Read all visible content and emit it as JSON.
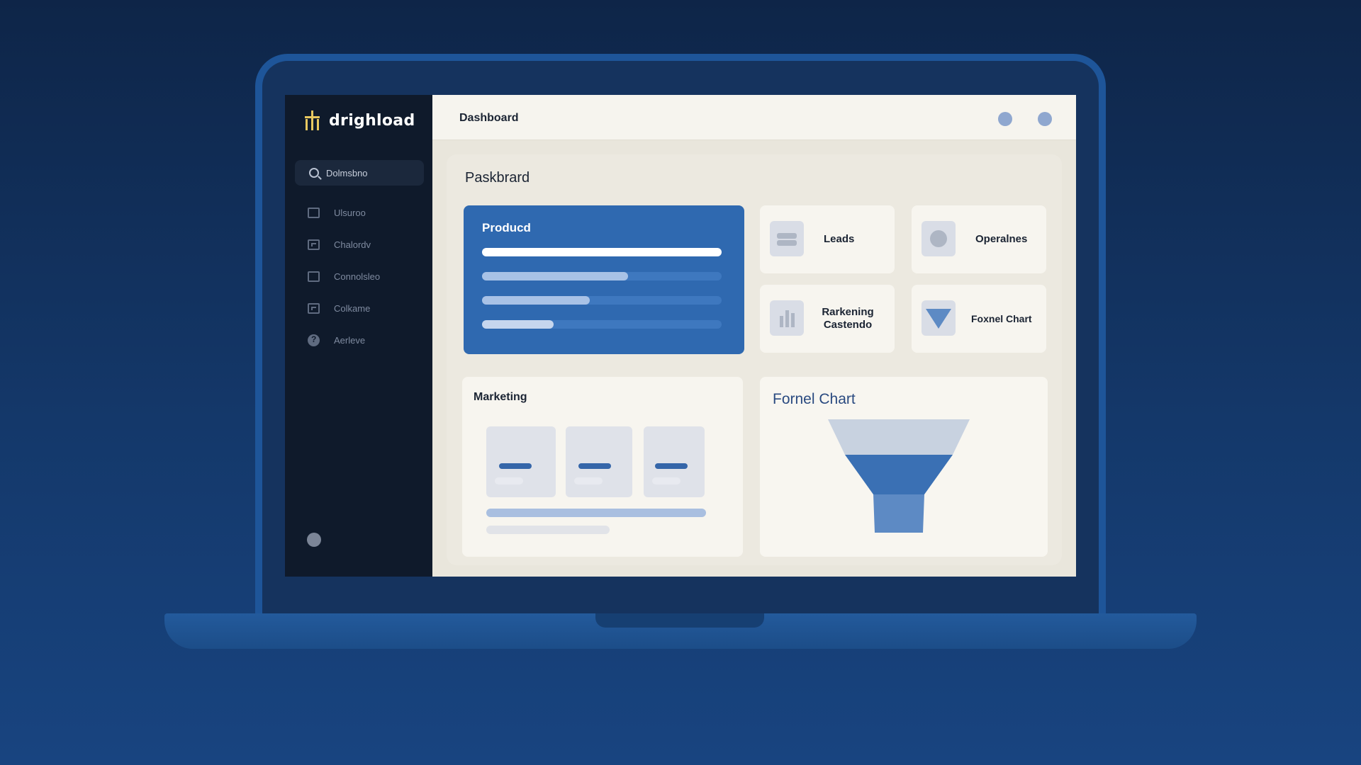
{
  "app": {
    "brand_name": "drighload"
  },
  "sidebar": {
    "search_label": "Dolmsbno",
    "items": [
      {
        "label": "Ulsuroo",
        "icon": "image-icon"
      },
      {
        "label": "Chalordv",
        "icon": "grid-icon"
      },
      {
        "label": "Connolsleo",
        "icon": "card-icon"
      },
      {
        "label": "Colkame",
        "icon": "calendar-icon"
      },
      {
        "label": "Aerleve",
        "icon": "help-icon"
      }
    ]
  },
  "header": {
    "title": "Dashboard"
  },
  "main": {
    "title": "Paskbrard",
    "product": {
      "title": "Producd",
      "bars": [
        {
          "fill": 1.0,
          "color": "#ffffff"
        },
        {
          "fill": 0.61,
          "color": "#a8c2e6"
        },
        {
          "fill": 0.45,
          "color": "#a8c2e6"
        },
        {
          "fill": 0.3,
          "color": "#c6d6ee"
        }
      ]
    },
    "tiles": [
      {
        "label_1": "Leads",
        "label_2": "",
        "icon": "stack-icon"
      },
      {
        "label_1": "Operalnes",
        "label_2": "",
        "icon": "circle-icon"
      },
      {
        "label_1": "Rarkening",
        "label_2": "Castendo",
        "icon": "bars-icon"
      },
      {
        "label_1": "Foxnel Chart",
        "label_2": "",
        "icon": "funnel-icon"
      }
    ],
    "marketing": {
      "title": "Marketing"
    },
    "funnel": {
      "title": "Fornel Chart"
    }
  },
  "colors": {
    "accent": "#2f69b0",
    "sidebar_bg": "#0f1a2b",
    "funnel_top": "#c8d2e0",
    "funnel_mid": "#3a70b4",
    "funnel_bottom": "#5d8ac4"
  }
}
